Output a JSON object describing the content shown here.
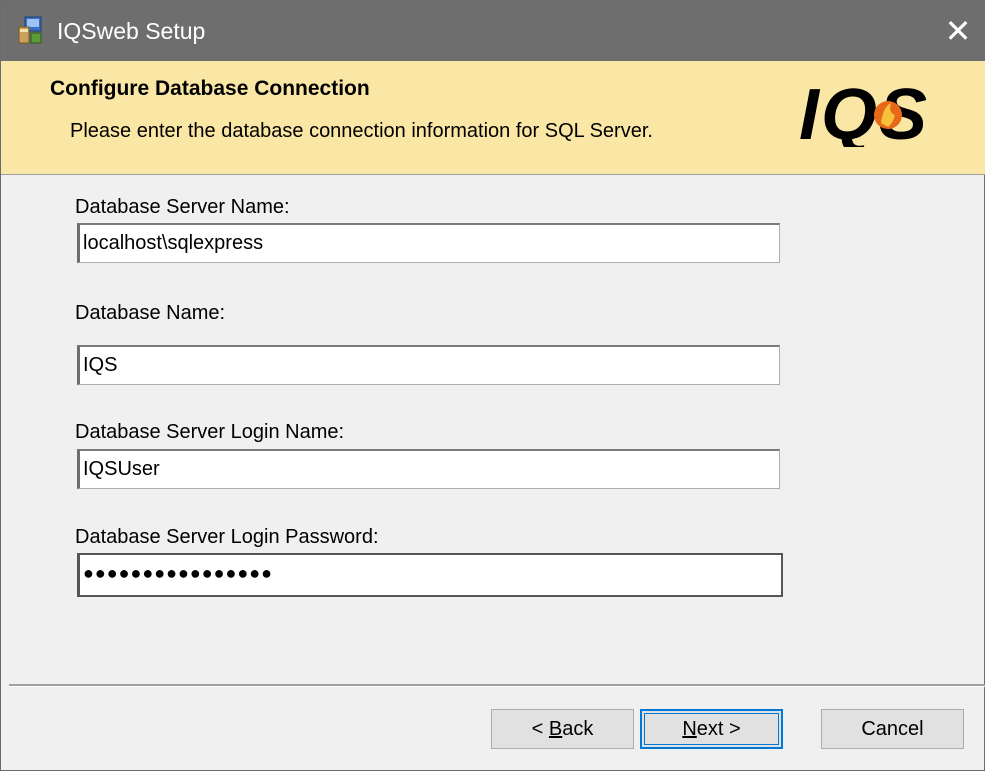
{
  "window": {
    "title": "IQSweb Setup",
    "icon": "installer-icon",
    "close_glyph": "✕"
  },
  "banner": {
    "title": "Configure Database Connection",
    "subtitle": "Please enter the database connection information for SQL Server.",
    "logo_text": "IQS"
  },
  "form": {
    "server_name": {
      "label": "Database Server Name:",
      "value": "localhost\\sqlexpress"
    },
    "database_name": {
      "label": "Database Name:",
      "value": "IQS"
    },
    "login_name": {
      "label": "Database Server Login Name:",
      "value": "IQSUser"
    },
    "login_password": {
      "label": "Database Server Login Password:",
      "value": "●●●●●●●●●●●●●●●●"
    }
  },
  "buttons": {
    "back": {
      "prefix": "< ",
      "mnemonic": "B",
      "rest": "ack"
    },
    "next": {
      "mnemonic": "N",
      "rest": "ext >"
    },
    "cancel": {
      "label": "Cancel"
    }
  },
  "colors": {
    "titlebar": "#6e6e6e",
    "banner": "#fbe7a5",
    "default_button_border": "#0078d7"
  }
}
